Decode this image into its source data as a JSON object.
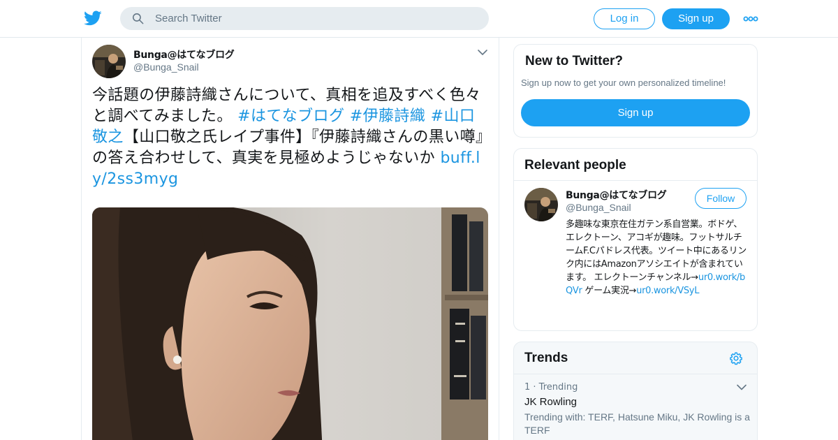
{
  "topbar": {
    "logo": "twitter-bird-icon",
    "search_placeholder": "Search Twitter",
    "login_label": "Log in",
    "signup_label": "Sign up",
    "more": "more-icon"
  },
  "tweet": {
    "author_name": "Bunga@はてなブログ",
    "author_handle": "@Bunga_Snail",
    "text_before": "今話題の伊藤詩織さんについて、真相を追及すべく色々と調べてみました。 ",
    "hashtag1": "#はてなブログ",
    "hashtag2": "#伊藤詩織",
    "hashtag3": "#山口敬之",
    "text_after": "【山口敬之氏レイプ事件】『伊藤詩織さんの黒い噂』の答え合わせして、真実を見極めようじゃないか ",
    "link": "buff.ly/2ss3myg"
  },
  "sidebar": {
    "new_to_twitter": {
      "title": "New to Twitter?",
      "subtitle": "Sign up now to get your own personalized timeline!",
      "button": "Sign up"
    },
    "relevant_people": {
      "title": "Relevant people",
      "name": "Bunga@はてなブログ",
      "handle": "@Bunga_Snail",
      "follow_label": "Follow",
      "bio_text1": "多趣味な東京在住ガテン系自営業。ボドゲ、エレクトーン、アコギが趣味。フットサルチームF.Cパドレス代表。ツイート中にあるリンク内にはAmazonアソシエイトが含まれています。 エレクトーンチャンネル→",
      "bio_link1": "ur0.work/bQVr",
      "bio_text2": " ゲーム実況→",
      "bio_link2": "ur0.work/VSyL"
    },
    "trends": {
      "title": "Trends",
      "items": [
        {
          "meta": "1 · Trending",
          "name": "JK Rowling",
          "with": "Trending with: TERF, Hatsune Miku, JK Rowling is a TERF"
        }
      ]
    }
  },
  "colors": {
    "brand_blue": "#1da1f2",
    "link_blue": "#1b95e0",
    "text_dark": "#14171a",
    "text_gray": "#657786"
  }
}
